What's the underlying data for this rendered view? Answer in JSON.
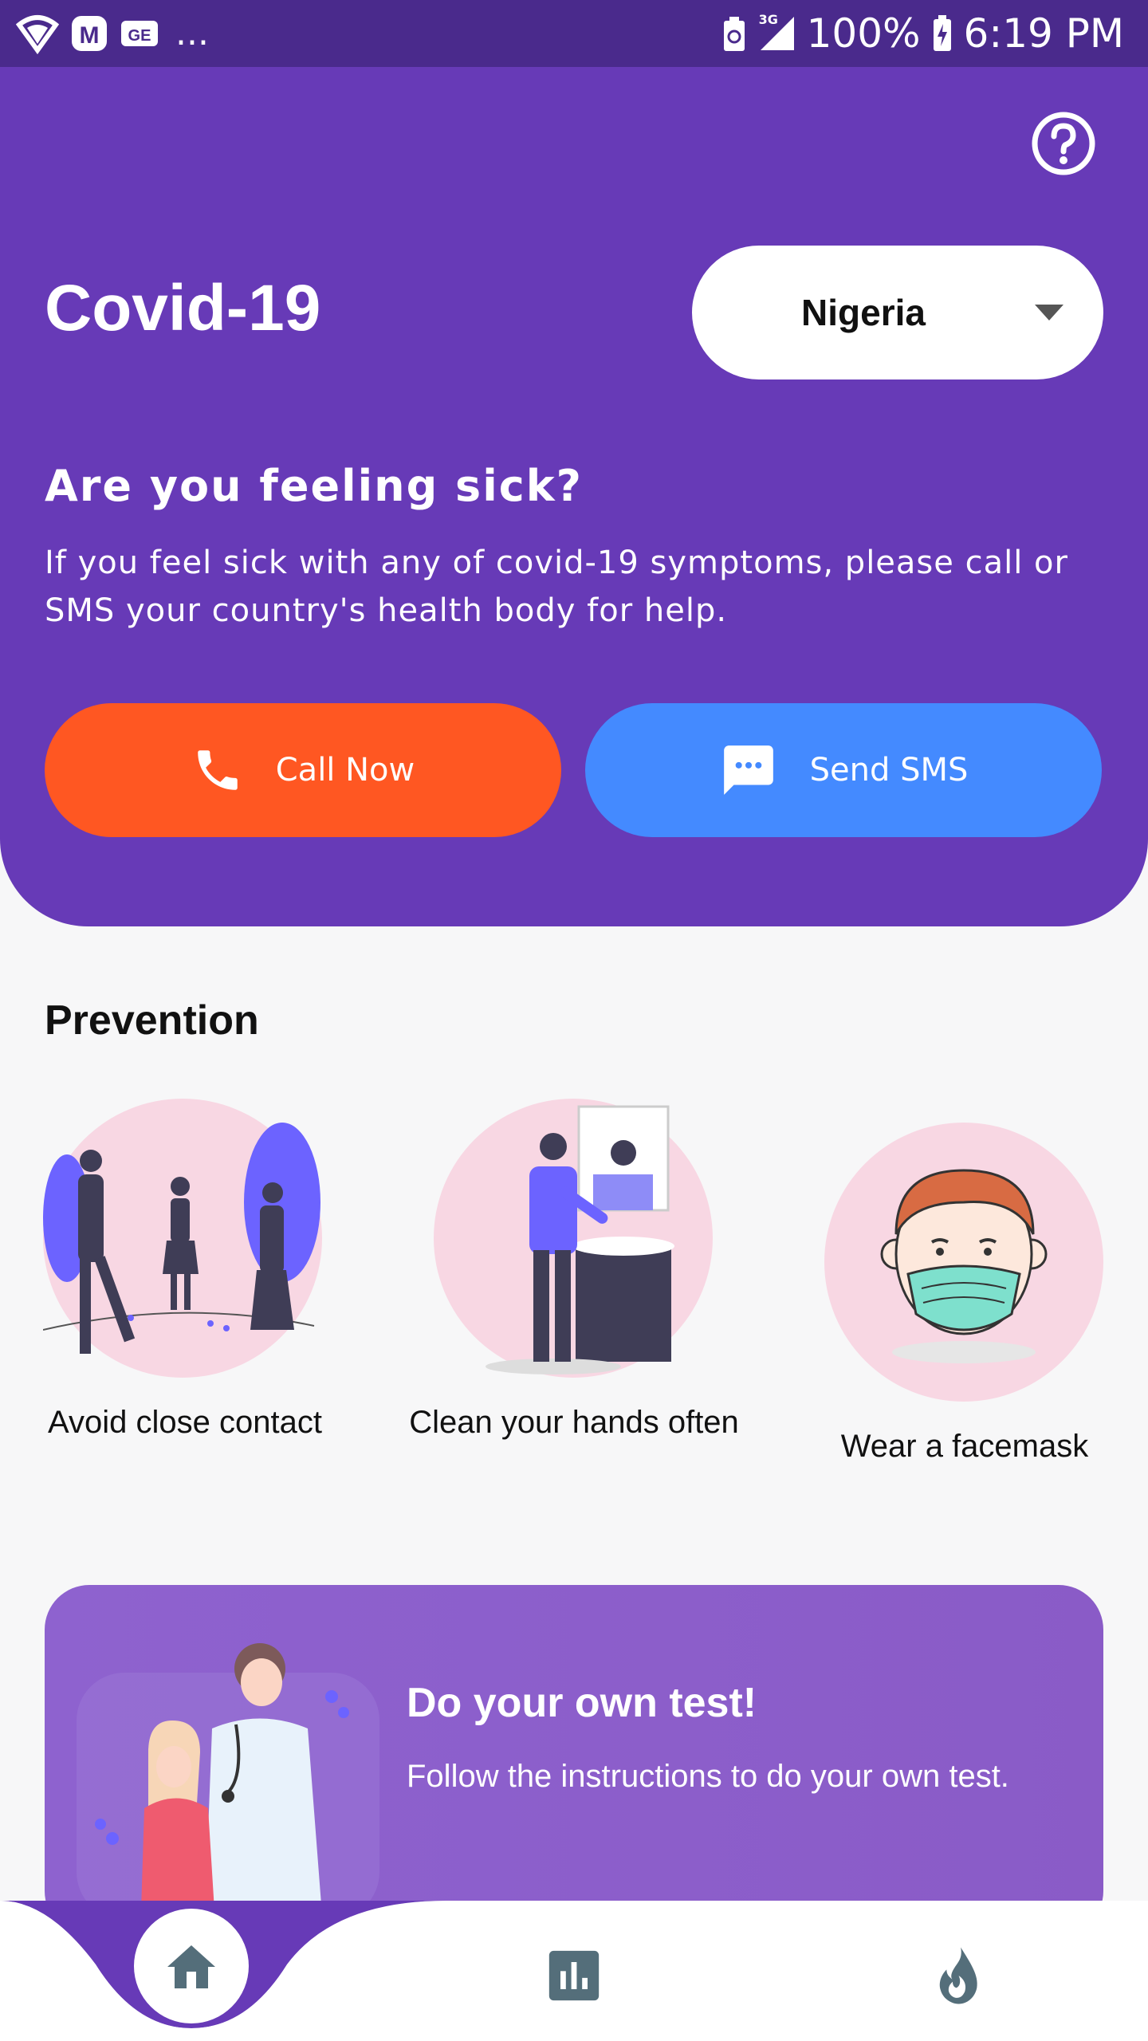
{
  "status_bar": {
    "left_icons": [
      "wifi-shield-icon",
      "m-app-icon",
      "ge-app-icon"
    ],
    "overflow": "...",
    "network": "3G",
    "battery": "100%",
    "time": "6:19 PM"
  },
  "header": {
    "title": "Covid-19",
    "country_select": {
      "value": "Nigeria"
    },
    "sick_title": "Are you feeling sick?",
    "sick_text": "If you feel sick with any of covid-19 symptoms, please call or SMS your country's health body for help.",
    "call_button": {
      "label": "Call Now",
      "icon": "phone-icon"
    },
    "sms_button": {
      "label": "Send SMS",
      "icon": "chat-icon"
    },
    "help_icon": "help-icon"
  },
  "prevention": {
    "title": "Prevention",
    "items": [
      {
        "label": "Avoid close contact",
        "image": "social-distance-illustration"
      },
      {
        "label": "Clean your hands often",
        "image": "handwash-illustration"
      },
      {
        "label": "Wear a facemask",
        "image": "facemask-illustration"
      }
    ]
  },
  "test_card": {
    "title": "Do your own test!",
    "text": "Follow the instructions to do your own test.",
    "image": "doctor-patient-illustration"
  },
  "bottom_nav": {
    "items": [
      {
        "name": "home",
        "icon": "home-icon",
        "active": true
      },
      {
        "name": "statistics",
        "icon": "bar-chart-icon",
        "active": false
      },
      {
        "name": "trending",
        "icon": "flame-icon",
        "active": false
      }
    ]
  },
  "colors": {
    "primary": "#673ab7",
    "status_bar": "#4a2a8c",
    "call": "#ff5722",
    "sms": "#448aff",
    "nav_icon": "#546e7a"
  }
}
